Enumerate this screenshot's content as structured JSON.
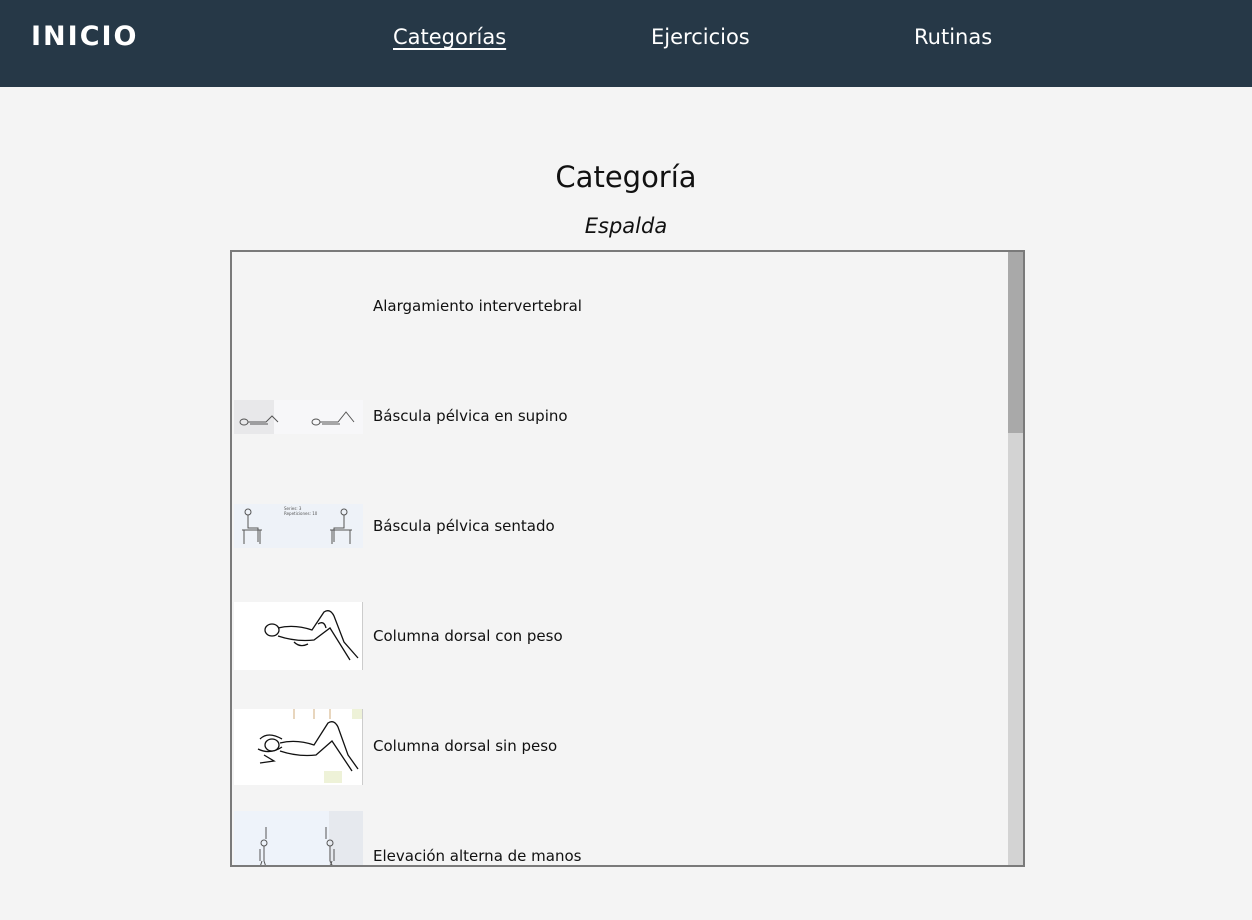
{
  "nav": {
    "brand": "INICIO",
    "links": [
      {
        "label": "Categorías",
        "active": true
      },
      {
        "label": "Ejercicios",
        "active": false
      },
      {
        "label": "Rutinas",
        "active": false
      }
    ]
  },
  "main": {
    "title": "Categoría",
    "category_name": "Espalda",
    "exercises": [
      {
        "label": "Alargamiento intervertebral",
        "image": "none"
      },
      {
        "label": "Báscula pélvica en supino",
        "image": "supine-figures-sketch"
      },
      {
        "label": "Báscula pélvica sentado",
        "image": "seated-figures-sketch",
        "image_text": "Series: 3 Repeticiones: 10"
      },
      {
        "label": "Columna dorsal con peso",
        "image": "lying-figure-sketch"
      },
      {
        "label": "Columna dorsal sin peso",
        "image": "lying-figure-hands-behind-head-sketch"
      },
      {
        "label": "Elevación alterna de manos",
        "image": "arm-raise-figures-sketch"
      }
    ]
  },
  "colors": {
    "nav_bg": "#263847",
    "page_bg": "#f4f4f4",
    "list_border": "#7a7a7a",
    "scroll_track": "#d3d3d3",
    "scroll_thumb": "#a9a9a9"
  }
}
